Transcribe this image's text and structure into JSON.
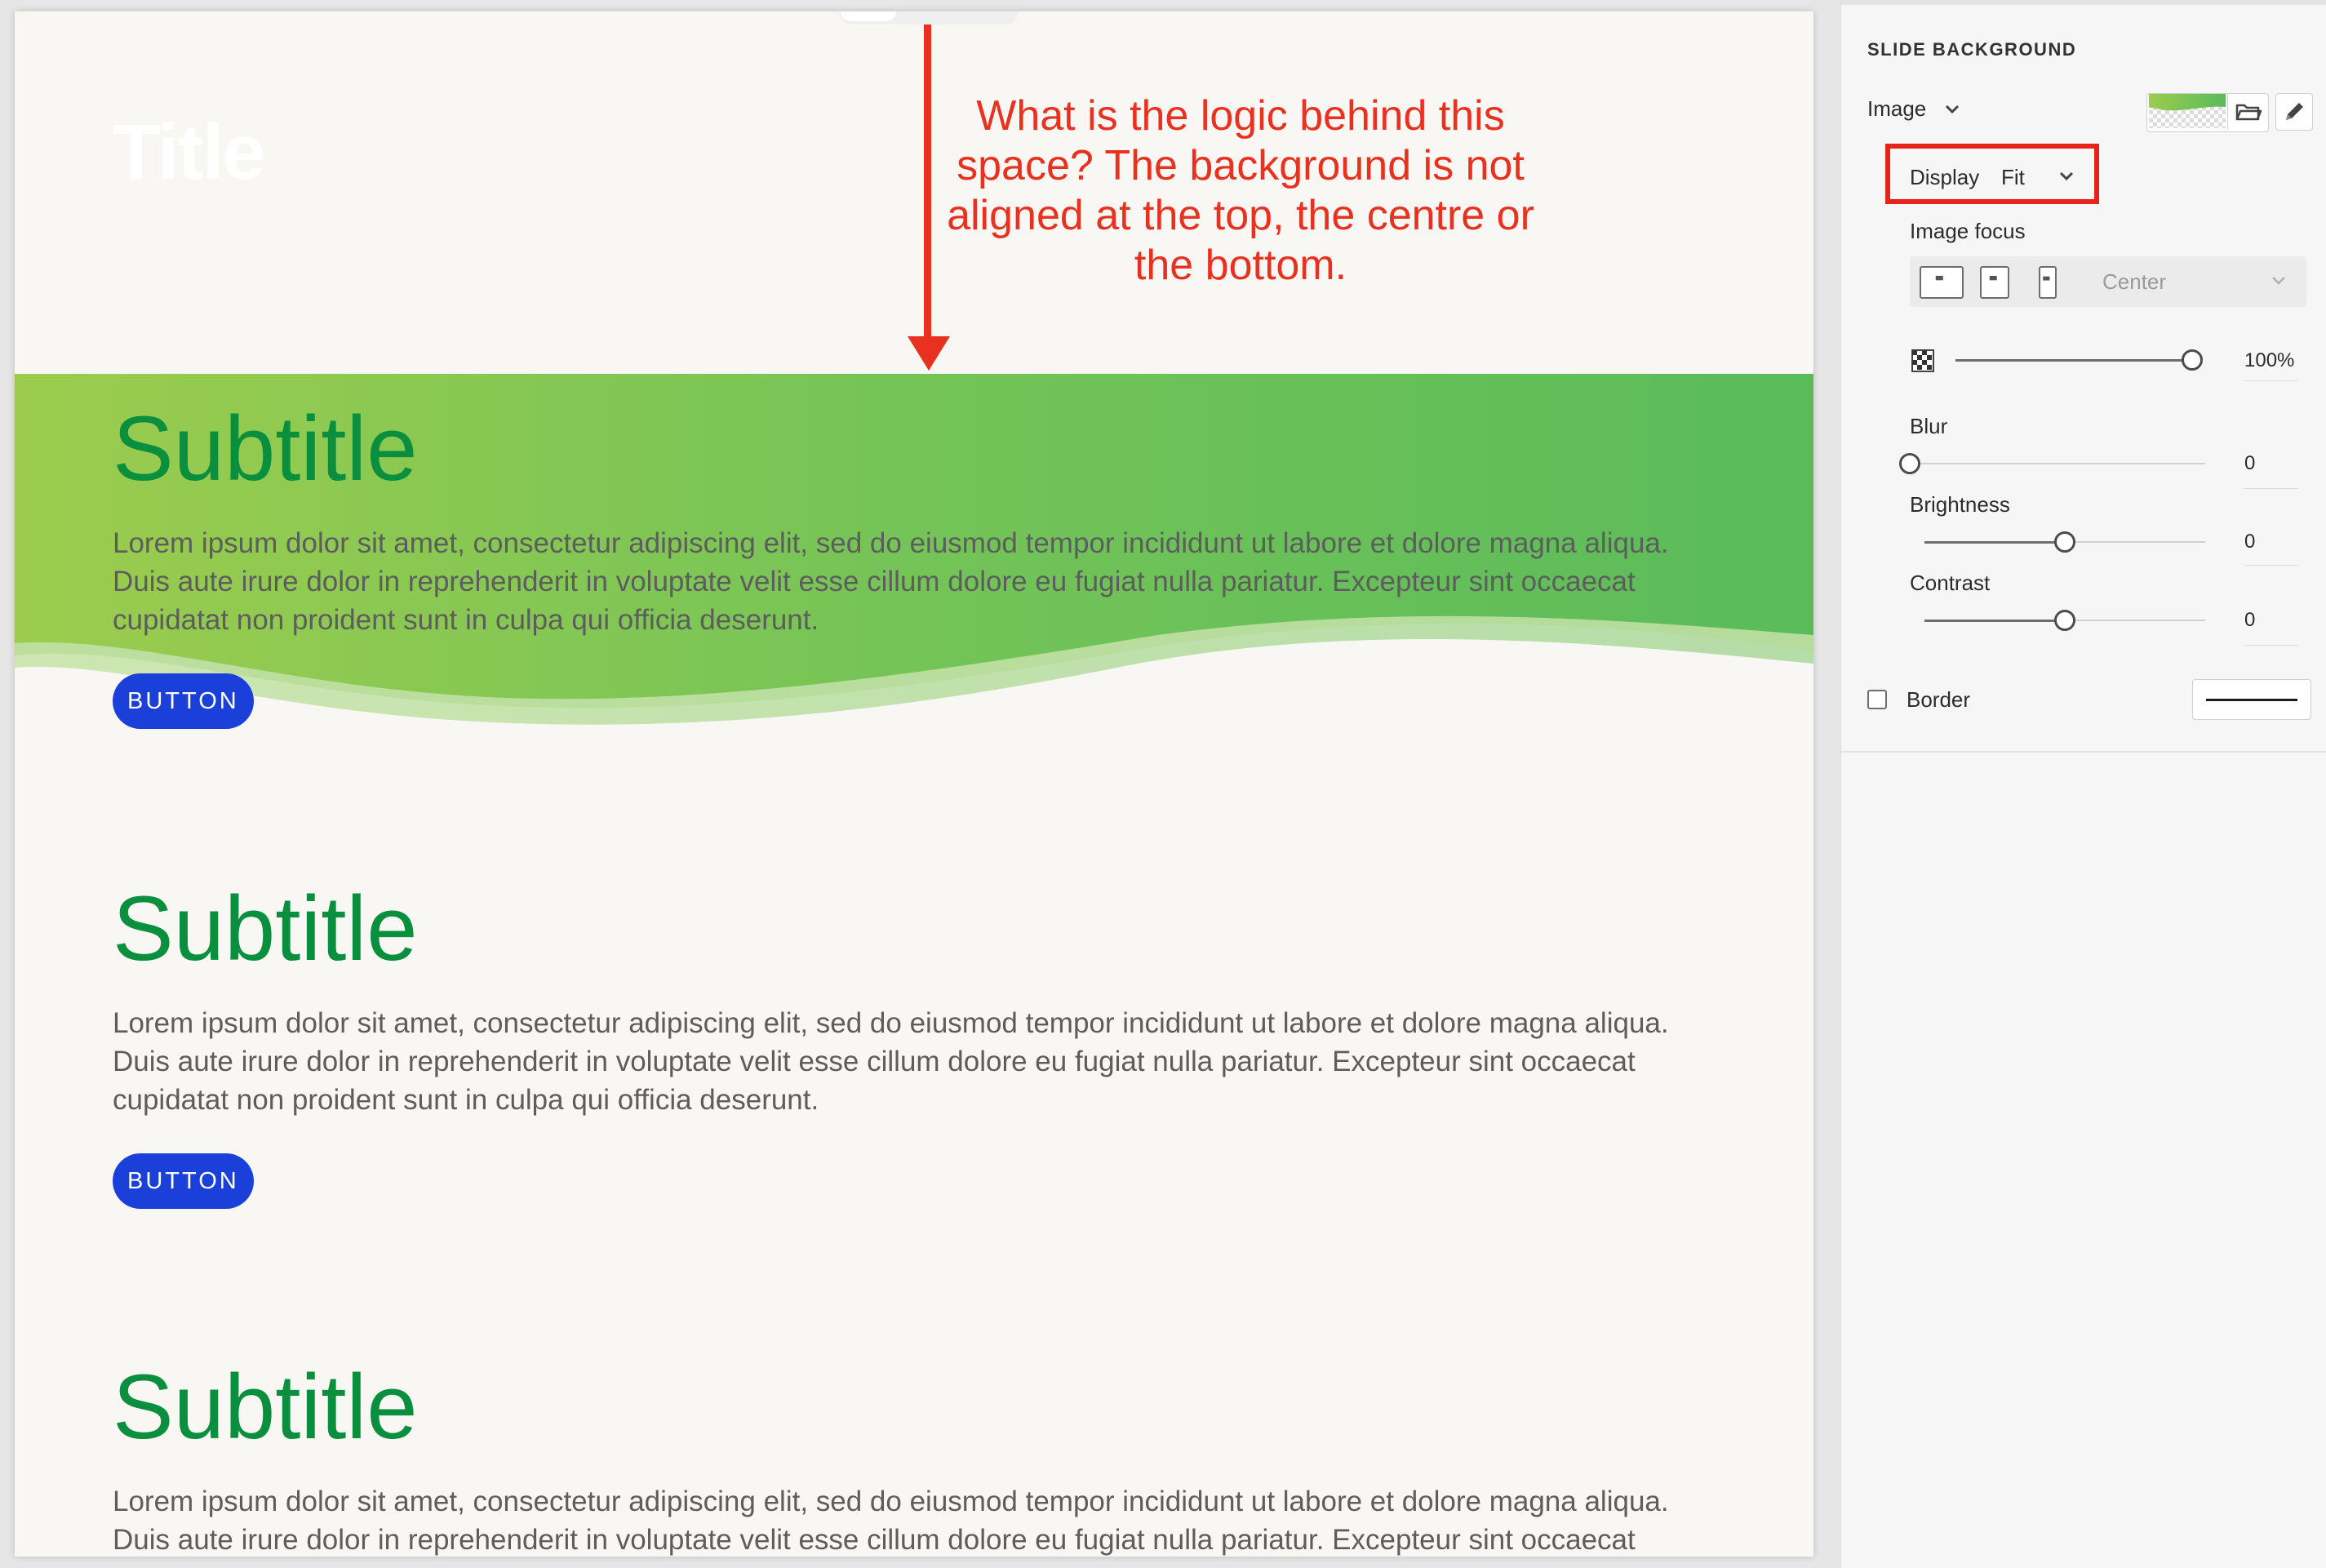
{
  "slide": {
    "title": "Title",
    "sections": [
      {
        "subtitle": "Subtitle",
        "body": "Lorem ipsum dolor sit amet, consectetur adipiscing elit, sed do eiusmod tempor incididunt ut labore et dolore magna aliqua. Duis aute irure dolor in reprehenderit in voluptate velit esse cillum dolore eu fugiat nulla pariatur. Excepteur sint occaecat cupidatat non proident sunt in culpa qui officia deserunt.",
        "button": "BUTTON"
      },
      {
        "subtitle": "Subtitle",
        "body": "Lorem ipsum dolor sit amet, consectetur adipiscing elit, sed do eiusmod tempor incididunt ut labore et dolore magna aliqua. Duis aute irure dolor in reprehenderit in voluptate velit esse cillum dolore eu fugiat nulla pariatur. Excepteur sint occaecat cupidatat non proident sunt in culpa qui officia deserunt.",
        "button": "BUTTON"
      },
      {
        "subtitle": "Subtitle",
        "body": "Lorem ipsum dolor sit amet, consectetur adipiscing elit, sed do eiusmod tempor incididunt ut labore et dolore magna aliqua. Duis aute irure dolor in reprehenderit in voluptate velit esse cillum dolore eu fugiat nulla pariatur. Excepteur sint occaecat cupidatat non proident sunt in culpa qui officia deserunt."
      }
    ]
  },
  "annotation": {
    "text": "What is the logic behind this space? The background is not aligned at the top, the centre or the bottom."
  },
  "panel": {
    "heading": "SLIDE BACKGROUND",
    "type_label": "Image",
    "display_label": "Display",
    "display_value": "Fit",
    "focus_label": "Image focus",
    "focus_value": "Center",
    "opacity": {
      "value": 1.0,
      "label": "100%"
    },
    "blur": {
      "label": "Blur",
      "value": "0",
      "level": 0.0
    },
    "brightness": {
      "label": "Brightness",
      "value": "0",
      "level": 0.5
    },
    "contrast": {
      "label": "Contrast",
      "value": "0",
      "level": 0.5
    },
    "border_label": "Border",
    "border_checked": false
  },
  "colors": {
    "accent_green": "#0a8f3e",
    "button_blue": "#1b3fd9",
    "annotation_red": "#e8321f",
    "banner_start": "#9ccc4e",
    "banner_end": "#5abb5a"
  },
  "icons": {
    "type_chevron": "chevron-down-icon",
    "folder": "folder-icon",
    "edit": "pencil-icon",
    "opacity": "checkerboard-icon"
  }
}
